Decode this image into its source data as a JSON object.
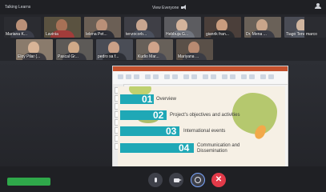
{
  "topbar": {
    "meeting_title": "Talking Learns",
    "view_mode": "View Everyone",
    "participants_icon": "people-icon"
  },
  "participants": [
    {
      "name": "Mariana K..."
    },
    {
      "name": "Lavinia"
    },
    {
      "name": "Ielena Pet..."
    },
    {
      "name": "tenzocorb..."
    },
    {
      "name": "Hebbuja G..."
    },
    {
      "name": "gianrik fran..."
    },
    {
      "name": "Dr. Mena ..."
    },
    {
      "name": "Tiago Tene..."
    },
    {
      "name": "marco"
    },
    {
      "name": "Eloy Pilar (..."
    },
    {
      "name": "Pascal Gr..."
    },
    {
      "name": "pedro sa f..."
    },
    {
      "name": "Kudio Mar..."
    },
    {
      "name": "Mariyana ..."
    }
  ],
  "slide": {
    "items": [
      {
        "num": "01",
        "text": "Overview"
      },
      {
        "num": "02",
        "text": "Project's objectives and activities"
      },
      {
        "num": "03",
        "text": "International events"
      },
      {
        "num": "04",
        "text": "Communication and Dissemination"
      }
    ]
  },
  "bottom": {
    "green_button": "",
    "buttons": [
      "mic-icon",
      "camera-icon",
      "share-screen-icon",
      "close-icon"
    ]
  },
  "colors": {
    "band": "#1fa8b6",
    "end_call": "#e23a49",
    "green_button": "#2fa84a",
    "slide_bg": "#f6f0e5"
  }
}
